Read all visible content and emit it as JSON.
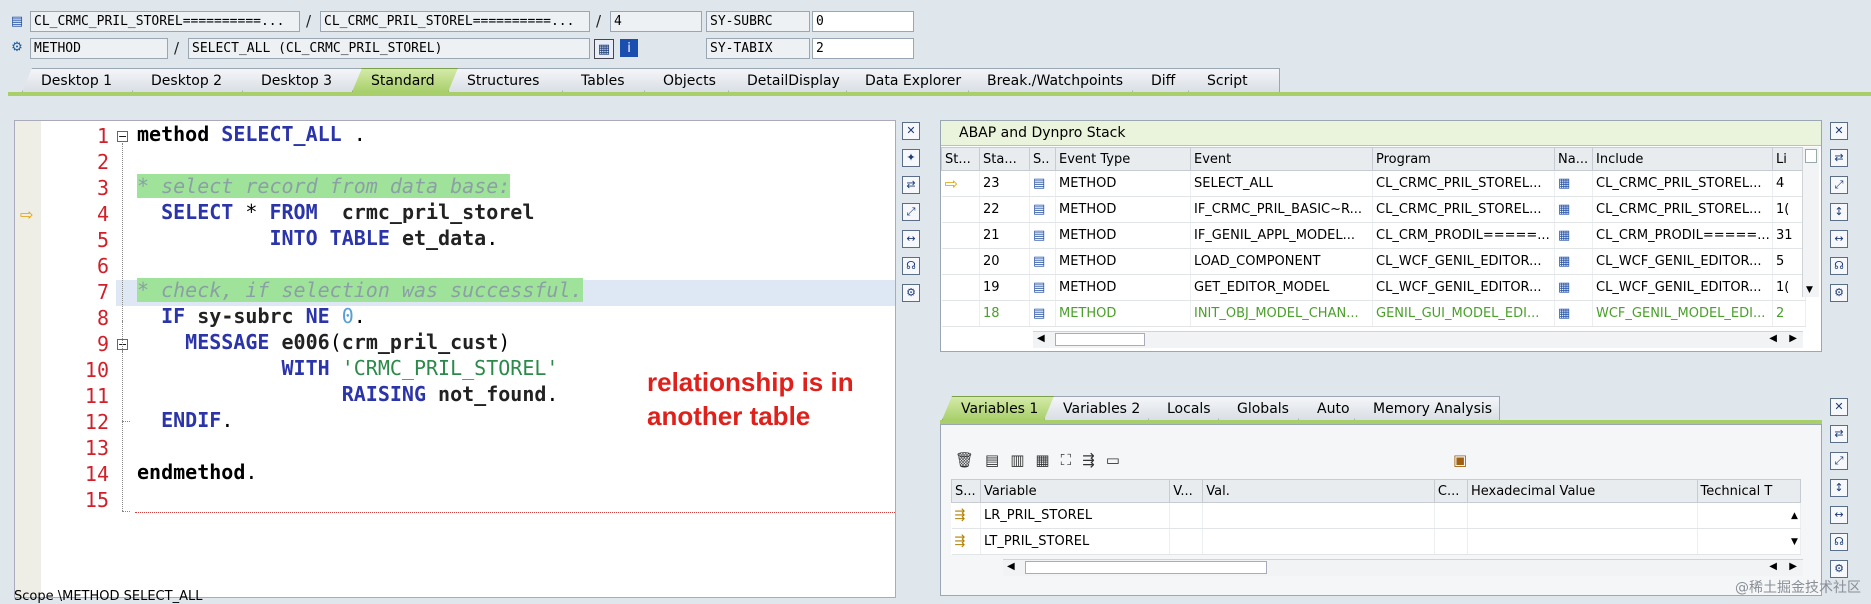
{
  "header": {
    "row1": {
      "class_field": "CL_CRMC_PRIL_STOREL==========...",
      "sep1": "/",
      "include_field": "CL_CRMC_PRIL_STOREL==========...",
      "sep2": "/",
      "line_field": "4",
      "sysvar_name": "SY-SUBRC",
      "sysvar_value": "0"
    },
    "row2": {
      "type_field": "METHOD",
      "sep": "/",
      "method_field": "SELECT_ALL (CL_CRMC_PRIL_STOREL)",
      "sysvar_name": "SY-TABIX",
      "sysvar_value": "2"
    }
  },
  "tabs": [
    {
      "label": "Desktop 1"
    },
    {
      "label": "Desktop 2"
    },
    {
      "label": "Desktop 3"
    },
    {
      "label": "Standard",
      "active": true
    },
    {
      "label": "Structures"
    },
    {
      "label": "Tables"
    },
    {
      "label": "Objects"
    },
    {
      "label": "DetailDisplay"
    },
    {
      "label": "Data Explorer"
    },
    {
      "label": "Break./Watchpoints"
    },
    {
      "label": "Diff"
    },
    {
      "label": "Script"
    }
  ],
  "editor": {
    "line_numbers": [
      "1",
      "2",
      "3",
      "4",
      "5",
      "6",
      "7",
      "8",
      "9",
      "10",
      "11",
      "12",
      "13",
      "14",
      "15"
    ],
    "annotation": [
      "relationship is in",
      "another table"
    ]
  },
  "stack": {
    "title": "ABAP and Dynpro Stack",
    "columns": [
      "St...",
      "Sta...",
      "S..",
      "Event Type",
      "Event",
      "Program",
      "Na...",
      "Include",
      "Li"
    ],
    "rows": [
      {
        "level": "23",
        "event_type": "METHOD",
        "event": "SELECT_ALL",
        "program": "CL_CRMC_PRIL_STOREL...",
        "include": "CL_CRMC_PRIL_STOREL...",
        "line": "4",
        "current": true
      },
      {
        "level": "22",
        "event_type": "METHOD",
        "event": "IF_CRMC_PRIL_BASIC~R...",
        "program": "CL_CRMC_PRIL_STOREL...",
        "include": "CL_CRMC_PRIL_STOREL...",
        "line": "1("
      },
      {
        "level": "21",
        "event_type": "METHOD",
        "event": "IF_GENIL_APPL_MODEL...",
        "program": "CL_CRM_PRODIL=====...",
        "include": "CL_CRM_PRODIL=====...",
        "line": "31"
      },
      {
        "level": "20",
        "event_type": "METHOD",
        "event": "LOAD_COMPONENT",
        "program": "CL_WCF_GENIL_EDITOR...",
        "include": "CL_WCF_GENIL_EDITOR...",
        "line": "5"
      },
      {
        "level": "19",
        "event_type": "METHOD",
        "event": "GET_EDITOR_MODEL",
        "program": "CL_WCF_GENIL_EDITOR...",
        "include": "CL_WCF_GENIL_EDITOR...",
        "line": "1("
      },
      {
        "level": "18",
        "event_type": "METHOD",
        "event": "INIT_OBJ_MODEL_CHAN...",
        "program": "GENIL_GUI_MODEL_EDI...",
        "include": "WCF_GENIL_MODEL_EDI...",
        "line": "2",
        "green": true
      }
    ]
  },
  "var_tabs": [
    {
      "label": "Variables 1",
      "active": true
    },
    {
      "label": "Variables 2"
    },
    {
      "label": "Locals"
    },
    {
      "label": "Globals"
    },
    {
      "label": "Auto"
    },
    {
      "label": "Memory Analysis"
    }
  ],
  "vars": {
    "columns": [
      "S...",
      "Variable",
      "V...",
      "Val.",
      "C...",
      "Hexadecimal Value",
      "Technical T"
    ],
    "rows": [
      {
        "name": "LR_PRIL_STOREL"
      },
      {
        "name": "LT_PRIL_STOREL"
      }
    ]
  },
  "status": {
    "text": "Scope \\METHOD SELECT_ALL"
  },
  "watermark": "@稀土掘金技术社区",
  "colors": {
    "tab_active": "#a8cf6a",
    "line_number": "#d0202a",
    "keyword": "#2b34a8",
    "comment_bg": "#9fe39a",
    "annotation": "#e0201a"
  }
}
